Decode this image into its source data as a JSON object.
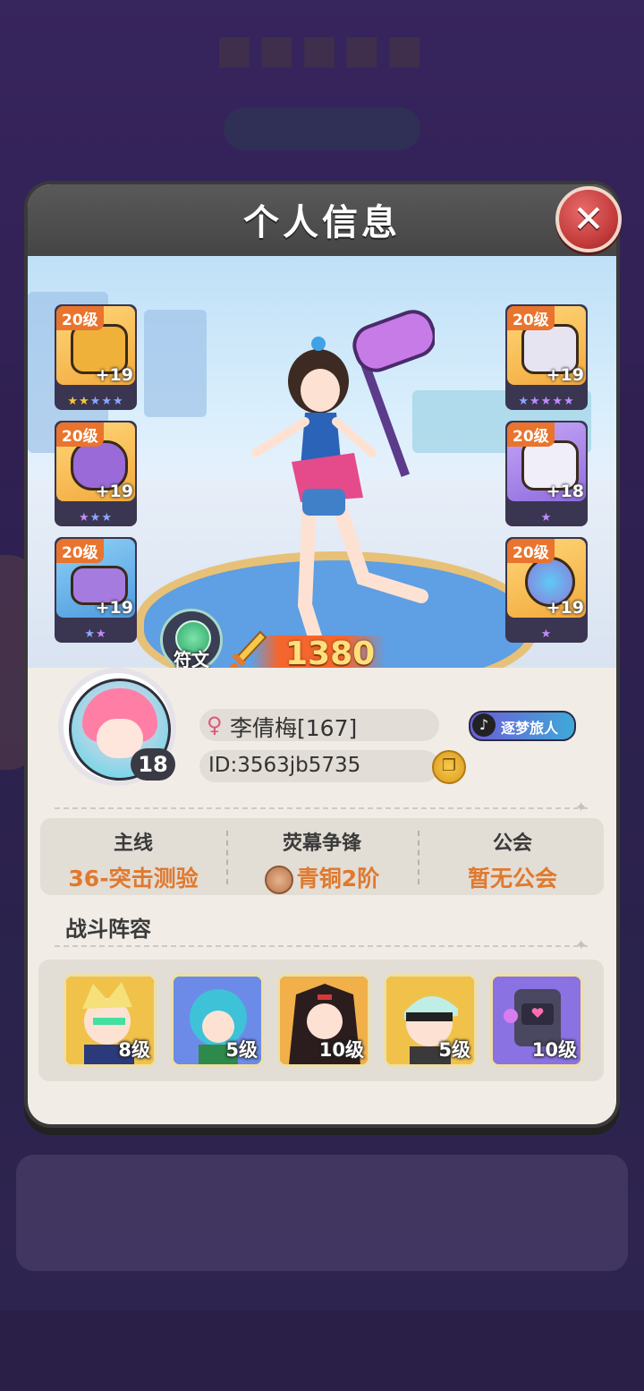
{
  "modal": {
    "title": "个人信息",
    "close_icon": "close-icon"
  },
  "equipment": {
    "left": [
      {
        "level": "20级",
        "plus": "+19",
        "stars": [
          "gold",
          "gold",
          "blue",
          "blue",
          "blue"
        ],
        "tier": "gold",
        "icon": "helmet-icon"
      },
      {
        "level": "20级",
        "plus": "+19",
        "stars": [
          "purple",
          "blue",
          "blue"
        ],
        "tier": "gold",
        "icon": "bracer-icon"
      },
      {
        "level": "20级",
        "plus": "+19",
        "stars": [
          "blue",
          "purple"
        ],
        "tier": "purple",
        "icon": "shoes-icon"
      }
    ],
    "right": [
      {
        "level": "20级",
        "plus": "+19",
        "stars": [
          "blue",
          "purple",
          "purple",
          "purple",
          "purple"
        ],
        "tier": "gold",
        "icon": "armor-icon"
      },
      {
        "level": "20级",
        "plus": "+18",
        "stars": [
          "purple"
        ],
        "tier": "purple",
        "icon": "pants-icon"
      },
      {
        "level": "20级",
        "plus": "+19",
        "stars": [
          "purple"
        ],
        "tier": "gold",
        "icon": "orb-icon"
      }
    ]
  },
  "rune": {
    "label": "符文",
    "icon": "rune-gem-icon"
  },
  "power": {
    "value": "1380",
    "icon": "sword-icon"
  },
  "profile": {
    "name": "李倩梅[167]",
    "gender_icon": "female-icon",
    "id": "ID:3563jb5735",
    "level": "18",
    "title_badge": "逐梦旅人",
    "copy_icon": "copy-icon"
  },
  "stats": [
    {
      "label": "主线",
      "value": "36-突击测验"
    },
    {
      "label": "荧幕争锋",
      "value": "青铜2阶"
    },
    {
      "label": "公会",
      "value": "暂无公会"
    }
  ],
  "team": {
    "title": "战斗阵容",
    "heroes": [
      {
        "level": "8级",
        "bg": "#f1c24a"
      },
      {
        "level": "5级",
        "bg": "#6c8be8"
      },
      {
        "level": "10级",
        "bg": "#f1b04a"
      },
      {
        "level": "5级",
        "bg": "#f1c24a"
      },
      {
        "level": "10级",
        "bg": "#8a72e2"
      }
    ]
  }
}
